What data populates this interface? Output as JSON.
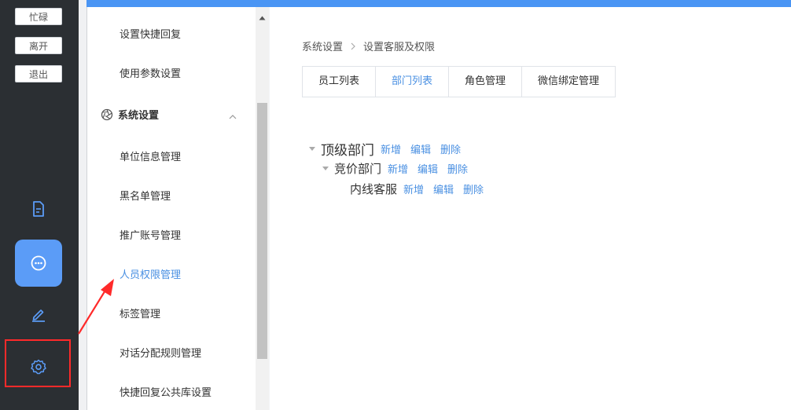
{
  "rail": {
    "status_buttons": [
      "忙碌",
      "离开",
      "退出"
    ],
    "icons": [
      "document-icon",
      "chat-icon",
      "edit-icon",
      "settings-icon"
    ]
  },
  "submenu": {
    "items_top": [
      "设置快捷回复",
      "使用参数设置"
    ],
    "group_label": "系统设置",
    "items": [
      "单位信息管理",
      "黑名单管理",
      "推广账号管理",
      "人员权限管理",
      "标签管理",
      "对话分配规则管理",
      "快捷回复公共库设置"
    ],
    "active_item": "人员权限管理"
  },
  "breadcrumb": [
    "系统设置",
    "设置客服及权限"
  ],
  "tabs": [
    "员工列表",
    "部门列表",
    "角色管理",
    "微信绑定管理"
  ],
  "active_tab": "部门列表",
  "tree": [
    {
      "name": "顶级部门",
      "actions": [
        "新增",
        "编辑",
        "删除"
      ]
    },
    {
      "name": "竞价部门",
      "actions": [
        "新增",
        "编辑",
        "删除"
      ]
    },
    {
      "name": "内线客服",
      "actions": [
        "新增",
        "编辑",
        "删除"
      ]
    }
  ],
  "colors": {
    "accent": "#4a90e2",
    "top_bar": "#4a95f4",
    "rail": "#2b2f33",
    "active_icon_bg": "#5b9cf7",
    "annotation_red": "#ff2a2a"
  }
}
